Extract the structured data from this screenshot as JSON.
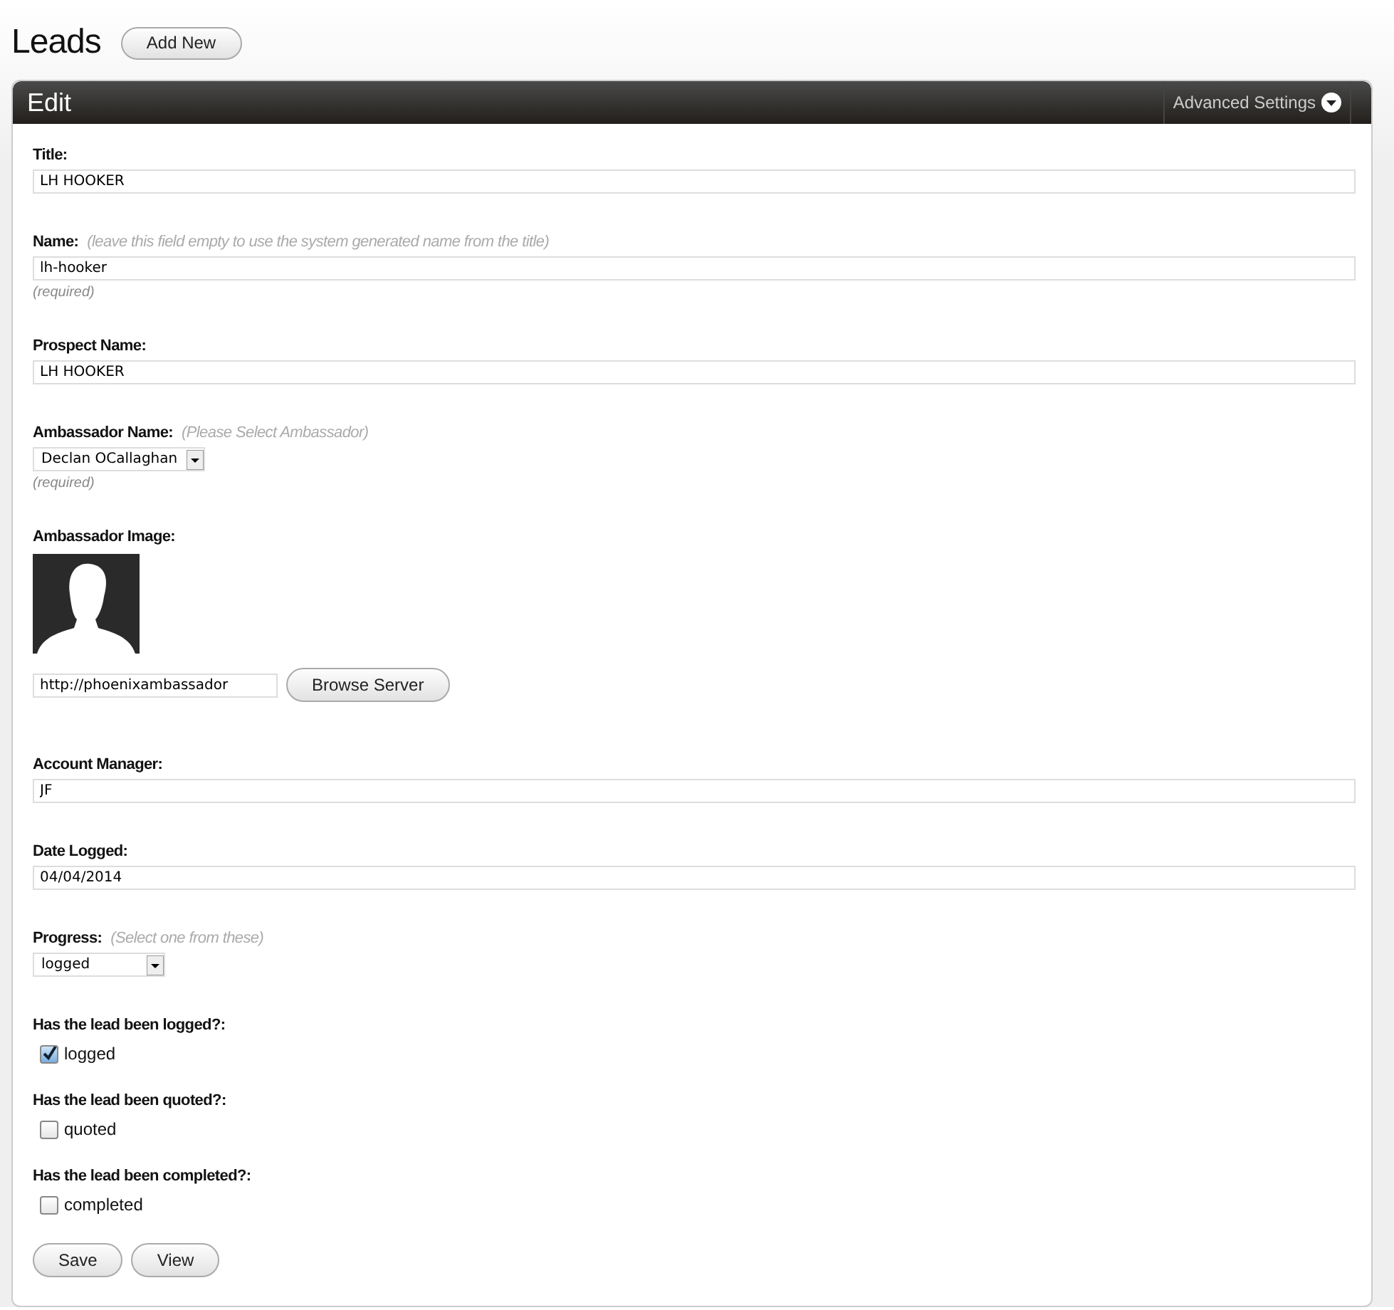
{
  "page": {
    "title": "Leads",
    "add_button": "Add New"
  },
  "panel": {
    "title": "Edit",
    "advanced_settings": "Advanced Settings"
  },
  "fields": [
    {
      "kind": "text",
      "label": "Title:",
      "value": "LH HOOKER"
    },
    {
      "kind": "text",
      "label": "Name:",
      "hint": "(leave this field empty to use the system generated name from the title)",
      "value": "lh-hooker",
      "note": "(required)"
    },
    {
      "kind": "text",
      "label": "Prospect Name:",
      "value": "LH HOOKER"
    },
    {
      "kind": "select",
      "label": "Ambassador Name:",
      "hint": "(Please Select Ambassador)",
      "value": "Declan OCallaghan",
      "note": "(required)"
    },
    {
      "kind": "image",
      "label": "Ambassador Image:",
      "value": "http://phoenixambassador",
      "button": "Browse Server"
    },
    {
      "kind": "text",
      "label": "Account Manager:",
      "value": "JF"
    },
    {
      "kind": "text",
      "label": "Date Logged:",
      "value": "04/04/2014"
    },
    {
      "kind": "select",
      "label": "Progress:",
      "hint": "(Select one from these)",
      "value": "logged"
    },
    {
      "kind": "checkbox",
      "label": "Has the lead been logged?:",
      "option": "logged",
      "checked": true
    },
    {
      "kind": "checkbox",
      "label": "Has the lead been quoted?:",
      "option": "quoted",
      "checked": false
    },
    {
      "kind": "checkbox",
      "label": "Has the lead been completed?:",
      "option": "completed",
      "checked": false
    }
  ],
  "buttons": [
    "Save",
    "View"
  ]
}
